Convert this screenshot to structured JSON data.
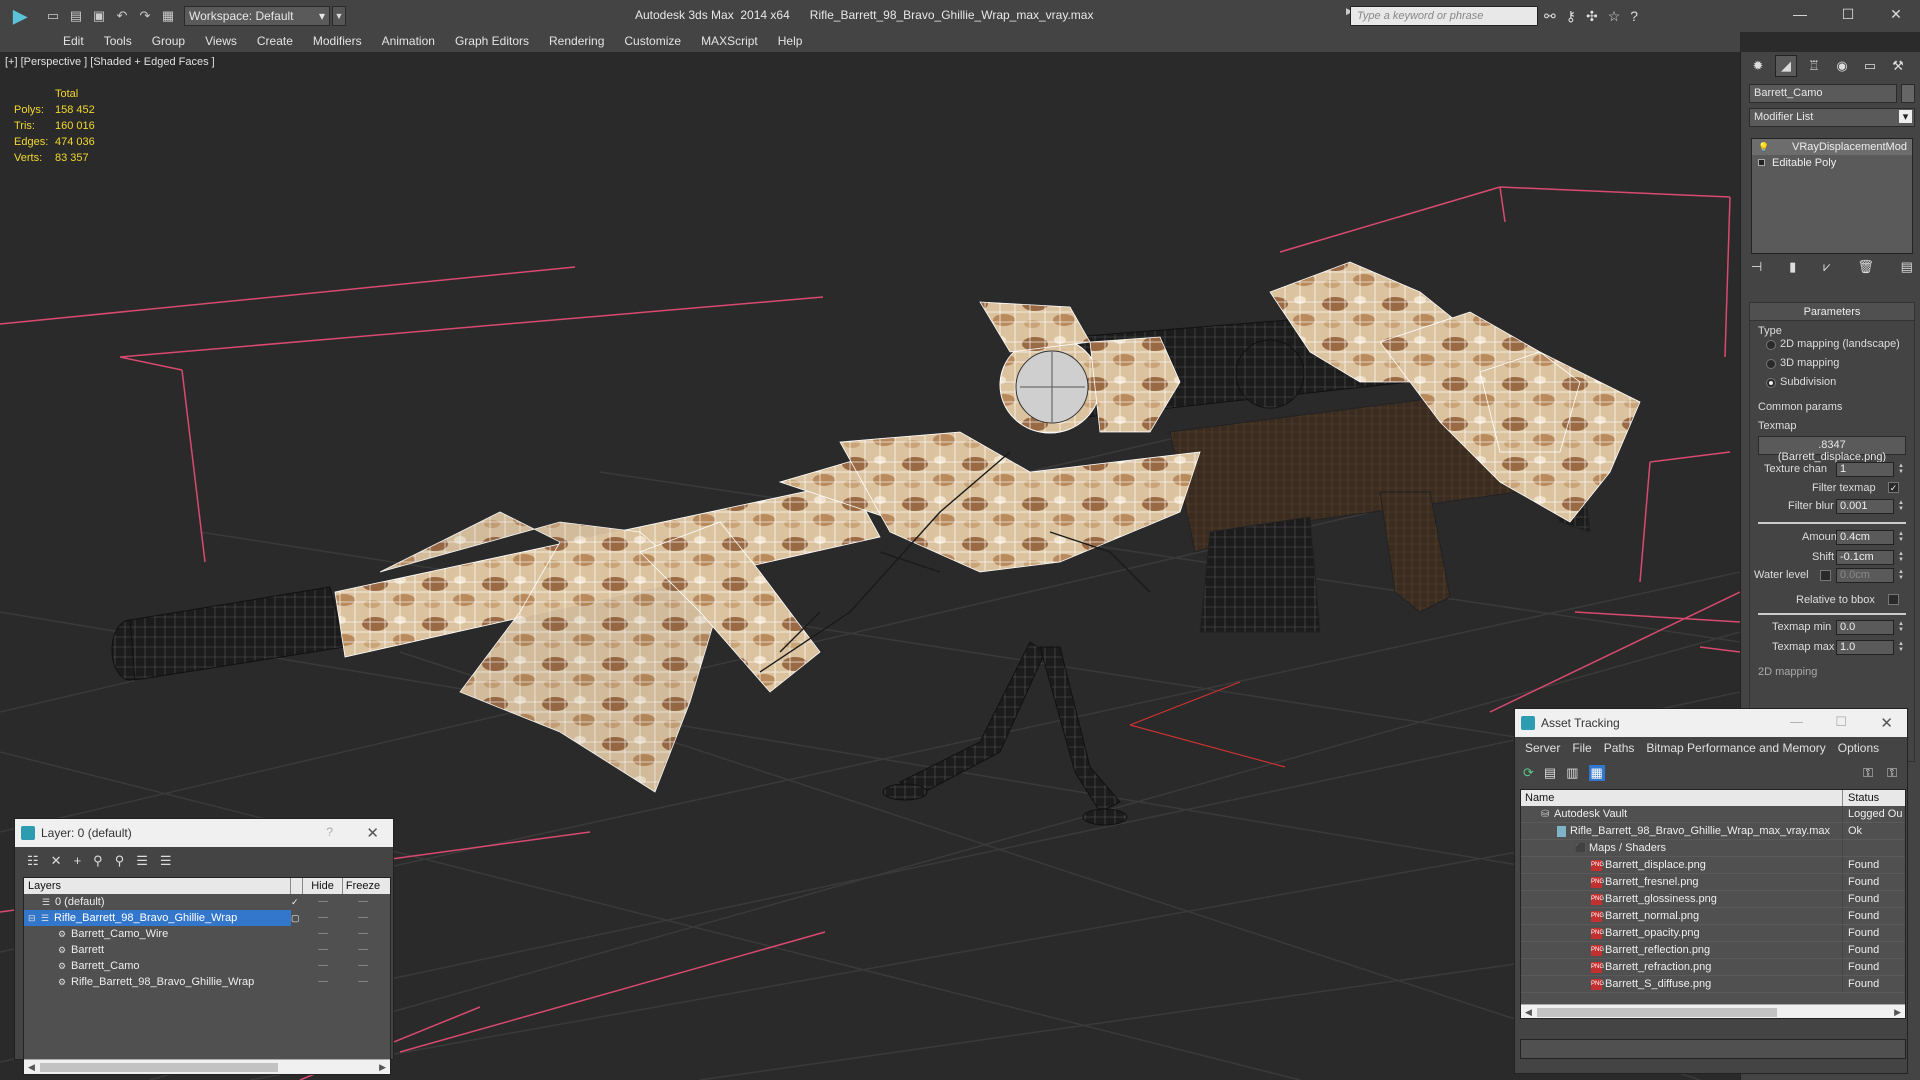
{
  "app": {
    "title": "Autodesk 3ds Max  2014 x64",
    "file": "Rifle_Barrett_98_Bravo_Ghillie_Wrap_max_vray.max",
    "workspace": "Workspace: Default",
    "search_placeholder": "Type a keyword or phrase"
  },
  "menu": [
    "Edit",
    "Tools",
    "Group",
    "Views",
    "Create",
    "Modifiers",
    "Animation",
    "Graph Editors",
    "Rendering",
    "Customize",
    "MAXScript",
    "Help"
  ],
  "viewport": {
    "label": "[+] [Perspective ] [Shaded + Edged Faces ]",
    "stats": {
      "header": "Total",
      "polys_label": "Polys:",
      "polys": "158 452",
      "tris_label": "Tris:",
      "tris": "160 016",
      "edges_label": "Edges:",
      "edges": "474 036",
      "verts_label": "Verts:",
      "verts": "83 357"
    }
  },
  "command_panel": {
    "object_name": "Barrett_Camo",
    "modifier_list": "Modifier List",
    "stack": [
      "VRayDisplacementMod",
      "Editable Poly"
    ],
    "params": {
      "title": "Parameters",
      "type_label": "Type",
      "opt1": "2D mapping (landscape)",
      "opt2": "3D mapping",
      "opt3": "Subdivision",
      "common": "Common params",
      "texmap_label": "Texmap",
      "texmap": ".8347 (Barrett_displace.png)",
      "texture_chan_label": "Texture chan",
      "texture_chan": "1",
      "filter_texmap_label": "Filter texmap",
      "filter_blur_label": "Filter blur",
      "filter_blur": "0.001",
      "amount_label": "Amount",
      "amount": "0.4cm",
      "shift_label": "Shift",
      "shift": "-0.1cm",
      "water_level_label": "Water level",
      "water_level": "0.0cm",
      "relative_label": "Relative to bbox",
      "texmap_min_label": "Texmap min",
      "texmap_min": "0.0",
      "texmap_max_label": "Texmap max",
      "texmap_max": "1.0",
      "next_rollout": "2D mapping"
    }
  },
  "layer_dialog": {
    "title": "Layer: 0 (default)",
    "help": "?",
    "columns": [
      "Layers",
      "Hide",
      "Freeze"
    ],
    "rows": [
      {
        "name": "0 (default)"
      },
      {
        "name": "Rifle_Barrett_98_Bravo_Ghillie_Wrap"
      },
      {
        "name": "Barrett_Camo_Wire"
      },
      {
        "name": "Barrett"
      },
      {
        "name": "Barrett_Camo"
      },
      {
        "name": "Rifle_Barrett_98_Bravo_Ghillie_Wrap"
      }
    ]
  },
  "asset_tracking": {
    "title": "Asset Tracking",
    "menu": [
      "Server",
      "File",
      "Paths",
      "Bitmap Performance and Memory",
      "Options"
    ],
    "columns": [
      "Name",
      "Status"
    ],
    "rows": [
      {
        "name": "Autodesk Vault",
        "status": "Logged Ou"
      },
      {
        "name": "Rifle_Barrett_98_Bravo_Ghillie_Wrap_max_vray.max",
        "status": "Ok"
      },
      {
        "name": "Maps / Shaders",
        "status": ""
      },
      {
        "name": "Barrett_displace.png",
        "status": "Found"
      },
      {
        "name": "Barrett_fresnel.png",
        "status": "Found"
      },
      {
        "name": "Barrett_glossiness.png",
        "status": "Found"
      },
      {
        "name": "Barrett_normal.png",
        "status": "Found"
      },
      {
        "name": "Barrett_opacity.png",
        "status": "Found"
      },
      {
        "name": "Barrett_reflection.png",
        "status": "Found"
      },
      {
        "name": "Barrett_refraction.png",
        "status": "Found"
      },
      {
        "name": "Barrett_S_diffuse.png",
        "status": "Found"
      }
    ]
  },
  "colors": {
    "stats": "#f0d830",
    "selection": "#3377cc",
    "ui_bg": "#444444",
    "viewport_bg": "#2a2a2a",
    "grid_line": "#3a3a3a",
    "bbox": "#d84a70",
    "camo_light": "#dfc6a4",
    "camo_dark": "#8a6040"
  }
}
